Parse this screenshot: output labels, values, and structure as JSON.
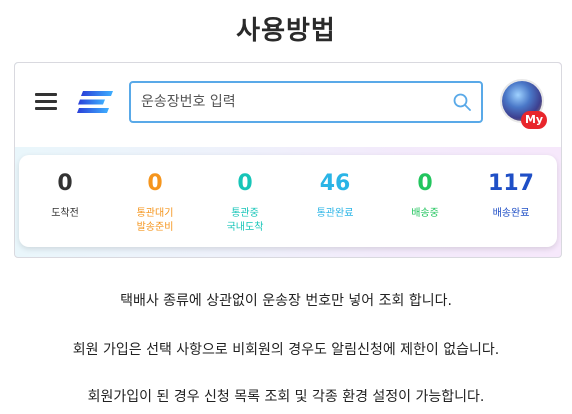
{
  "page": {
    "title": "사용방법"
  },
  "topbar": {
    "search_placeholder": "운송장번호 입력",
    "avatar_badge": "My"
  },
  "stats": [
    {
      "value": "0",
      "label1": "도착전",
      "label2": "",
      "color": "#333333"
    },
    {
      "value": "0",
      "label1": "통관대기",
      "label2": "발송준비",
      "color": "#f5951d"
    },
    {
      "value": "0",
      "label1": "통관중",
      "label2": "국내도착",
      "color": "#17c5b8"
    },
    {
      "value": "46",
      "label1": "통관완료",
      "label2": "",
      "color": "#2ab4e6"
    },
    {
      "value": "0",
      "label1": "배송중",
      "label2": "",
      "color": "#22c55e"
    },
    {
      "value": "117",
      "label1": "배송완료",
      "label2": "",
      "color": "#1f4fc6"
    }
  ],
  "descriptions": [
    "택배사 종류에 상관없이 운송장 번호만 넣어 조회 합니다.",
    "회원 가입은 선택 사항으로 비회원의 경우도 알림신청에 제한이 없습니다.",
    "회원가입이 된 경우 신청 목록 조회 및 각종 환경 설정이 가능합니다."
  ],
  "icons": {
    "menu": "hamburger-menu-icon",
    "logo": "brand-logo-icon",
    "search": "search-icon",
    "avatar": "user-avatar"
  }
}
